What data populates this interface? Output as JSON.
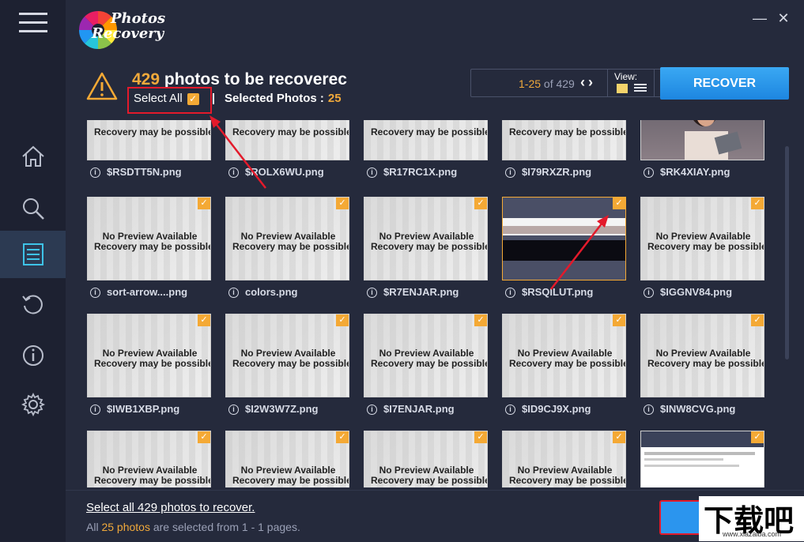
{
  "app": {
    "logo_line1": "Photos",
    "logo_line2": "Recovery",
    "minimize": "—",
    "close": "✕"
  },
  "sidebar": {
    "items": [
      "home-icon",
      "search-icon",
      "list-icon",
      "history-icon",
      "info-icon",
      "gear-icon"
    ],
    "active_index": 2
  },
  "header": {
    "count": "429",
    "title_rest": "photos to be recoverec",
    "select_all_label": "Select All",
    "selected_label": "Selected Photos :",
    "selected_value": "25",
    "pager_range": "1-25",
    "pager_of": "of 429",
    "view_label": "View:",
    "recover_label": "RECOVER"
  },
  "grid": {
    "rows": [
      [
        {
          "name": "$RSDTT5N.png",
          "type": "placeholder",
          "partial": true
        },
        {
          "name": "$ROLX6WU.png",
          "type": "placeholder",
          "partial": true
        },
        {
          "name": "$R17RC1X.png",
          "type": "placeholder",
          "partial": true
        },
        {
          "name": "$I79RXZR.png",
          "type": "placeholder",
          "partial": true
        },
        {
          "name": "$RK4XIAY.png",
          "type": "photo",
          "partial": true
        }
      ],
      [
        {
          "name": "sort-arrow....png",
          "type": "placeholder"
        },
        {
          "name": "colors.png",
          "type": "placeholder"
        },
        {
          "name": "$R7ENJAR.png",
          "type": "placeholder"
        },
        {
          "name": "$RSQILUT.png",
          "type": "image"
        },
        {
          "name": "$IGGNV84.png",
          "type": "placeholder"
        }
      ],
      [
        {
          "name": "$IWB1XBP.png",
          "type": "placeholder"
        },
        {
          "name": "$I2W3W7Z.png",
          "type": "placeholder"
        },
        {
          "name": "$I7ENJAR.png",
          "type": "placeholder"
        },
        {
          "name": "$ID9CJ9X.png",
          "type": "placeholder"
        },
        {
          "name": "$INW8CVG.png",
          "type": "placeholder"
        }
      ],
      [
        {
          "name": "",
          "type": "placeholder"
        },
        {
          "name": "",
          "type": "placeholder"
        },
        {
          "name": "",
          "type": "placeholder"
        },
        {
          "name": "",
          "type": "placeholder"
        },
        {
          "name": "",
          "type": "screenshot"
        }
      ]
    ],
    "no_preview_text": "No Preview Available",
    "recovery_text": "Recovery may be possible"
  },
  "footer": {
    "select_all_link": "Select all 429 photos to recover.",
    "status_prefix": "All",
    "status_hl": "25 photos",
    "status_suffix": "are selected from 1 - 1 pages."
  },
  "watermark": {
    "text": "下载吧",
    "sub": "www.xiazaiba.com"
  },
  "colors": {
    "accent": "#f0a93b",
    "primary": "#1d86e0",
    "highlight_red": "#e31a2b"
  }
}
